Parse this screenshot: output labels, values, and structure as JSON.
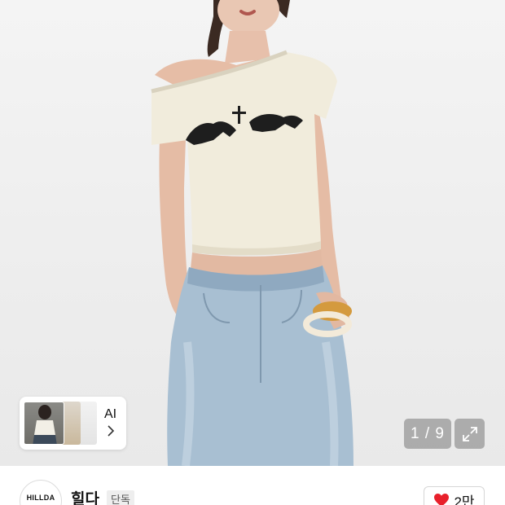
{
  "gallery": {
    "ai_chip_label": "AI",
    "counter": "1 / 9"
  },
  "brand": {
    "logo_text": "HILLDA",
    "name": "힐다",
    "badge": "단독"
  },
  "like": {
    "count": "2만"
  },
  "colors": {
    "heart": "#e8202b",
    "counter_bg": "#8a8a8a"
  },
  "icons": [
    "chevron-right-icon",
    "expand-icon",
    "heart-icon"
  ]
}
